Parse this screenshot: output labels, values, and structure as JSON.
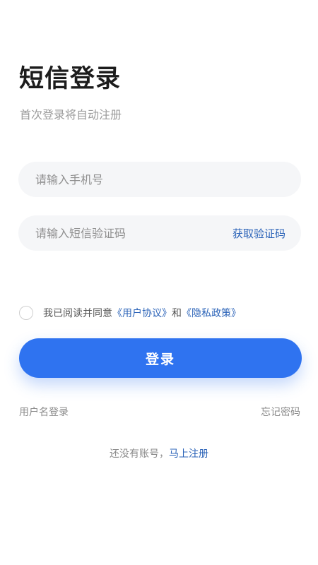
{
  "page": {
    "title": "短信登录",
    "subtitle": "首次登录将自动注册"
  },
  "form": {
    "phone_placeholder": "请输入手机号",
    "code_placeholder": "请输入短信验证码",
    "get_code_label": "获取验证码"
  },
  "agreement": {
    "prefix": "我已阅读并同意",
    "user_agreement": "《用户协议》",
    "and": "和",
    "privacy_policy": "《隐私政策》",
    "checked": false
  },
  "actions": {
    "login_label": "登录",
    "username_login": "用户名登录",
    "forgot_password": "忘记密码"
  },
  "register": {
    "prompt": "还没有账号，",
    "link": "马上注册"
  },
  "colors": {
    "primary": "#2f73f0",
    "link": "#2b63b8",
    "field_bg": "#f5f6f8",
    "muted_text": "#8a8a8a"
  }
}
